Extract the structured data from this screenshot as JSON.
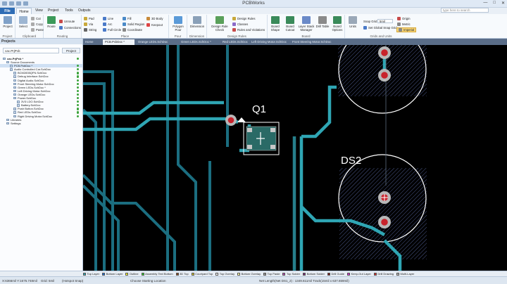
{
  "window": {
    "title": "PCBWorks"
  },
  "menu": {
    "tabs": [
      "File",
      "Home",
      "View",
      "Project",
      "Tools",
      "Outputs"
    ]
  },
  "search": {
    "placeholder": "type here to search"
  },
  "ribbon": {
    "groups": {
      "project": "Project",
      "clipboard": "Clipboard",
      "routing": "Routing",
      "place": "Place",
      "pour": "Pour",
      "dimension": "Dimension",
      "design_rules": "Design Rules",
      "board": "Board",
      "grids_units": "Grids and Units"
    },
    "buttons": {
      "project": "Project",
      "select": "Select",
      "cut": "Cut",
      "copy": "Copy",
      "paste": "Paste",
      "route": "Route",
      "unroute": "Unroute",
      "connections": "Connections",
      "pad": "Pad",
      "via": "Via",
      "string": "String",
      "line": "Line",
      "arc": "Arc",
      "full_circle": "Full Circle",
      "fill": "Fill",
      "solid_region": "Solid Region",
      "coordinate": "Coordinate",
      "3d_body": "3D Body",
      "keepout": "Keepout",
      "polygon_pour": "Polygon Pour",
      "dimension": "Dimension",
      "design_rule_check": "Design Rule Check",
      "design_rules": "Design Rules",
      "classes": "Classes",
      "rules_violations": "Rules and Violations",
      "board_shape": "Board Shape",
      "board_cutout": "Board Cutout",
      "layer_stack_manager": "Layer Stack Manager",
      "drill_table": "Drill Table",
      "board_options": "Board Options",
      "units": "Units",
      "snap_grid": "Snap Grid",
      "snap_grid_value": "5mil",
      "set_global_snap_grid": "Set Global Snap Grid...",
      "origin": "Origin",
      "metric": "Metric",
      "imperial": "Imperial"
    }
  },
  "projects_panel": {
    "title": "Projects",
    "filter_value": "cac.PrjPcb",
    "project_button": "Project",
    "tree": [
      {
        "label": "cac.PrjPcb *",
        "indent": 0,
        "bold": true,
        "dot": true
      },
      {
        "label": "Source Documents",
        "indent": 1,
        "dot": false
      },
      {
        "label": "PCB.PcbDoc *",
        "indent": 2,
        "dot": true,
        "selected": true
      },
      {
        "label": "Audio Controlled Car.SchDoc",
        "indent": 2,
        "dot": true
      },
      {
        "label": "BCM2835QFN.SchDoc",
        "indent": 3,
        "dot": true
      },
      {
        "label": "Debug Interface.SchDoc",
        "indent": 3,
        "dot": true
      },
      {
        "label": "Digital Audio.SchDoc",
        "indent": 3,
        "dot": true
      },
      {
        "label": "Front Steering Motor.SchDoc",
        "indent": 3,
        "dot": true
      },
      {
        "label": "Green LEDs.SchDoc *",
        "indent": 3,
        "dot": true
      },
      {
        "label": "Left Driving Motor.SchDoc",
        "indent": 3,
        "dot": true
      },
      {
        "label": "Orange LEDs.SchDoc",
        "indent": 3,
        "dot": true
      },
      {
        "label": "Power.SchDoc",
        "indent": 3,
        "dot": true
      },
      {
        "label": "3V3 LDO.SchDoc",
        "indent": 4,
        "dot": true
      },
      {
        "label": "Battery.SchDoc",
        "indent": 4,
        "dot": true
      },
      {
        "label": "Push Button.SchDoc",
        "indent": 3,
        "dot": true
      },
      {
        "label": "Red LEDs.SchDoc",
        "indent": 3,
        "dot": true
      },
      {
        "label": "Right Driving Motor.SchDoc",
        "indent": 3,
        "dot": true
      },
      {
        "label": "Libraries",
        "indent": 1,
        "dot": false
      },
      {
        "label": "Settings",
        "indent": 1,
        "dot": false
      }
    ]
  },
  "doc_tabs": [
    {
      "label": "Home",
      "active": false
    },
    {
      "label": "PCB.PcbDoc *",
      "active": true
    },
    {
      "label": "Orange LEDs.SchDoc",
      "active": false
    },
    {
      "label": "Green LEDs.SchDoc *",
      "active": false
    },
    {
      "label": "Red LEDs.SchDoc",
      "active": false
    },
    {
      "label": "Left Driving Motor.SchDoc",
      "active": false
    },
    {
      "label": "Front Steering Motor.SchDoc",
      "active": false
    }
  ],
  "pcb": {
    "designators": {
      "q1": "Q1",
      "ds2": "DS2"
    },
    "colors": {
      "background": "#000000",
      "top_layer_track": "#2fa6b4",
      "bottom_layer_track": "#1b6e80",
      "pad": "#b8b8b8",
      "pad_hole": "#c8232c",
      "overlay": "#ffffff",
      "component_body": "#2a6a66"
    }
  },
  "layers": [
    {
      "name": "Top Layer",
      "color": "#2fa6b4"
    },
    {
      "name": "Bottom Layer",
      "color": "#1f6ed4"
    },
    {
      "name": "Outline",
      "color": "#ffff33"
    },
    {
      "name": "Assembly Text Bottom",
      "color": "#2ed42e"
    },
    {
      "name": "3D Top",
      "color": "#8a4a20"
    },
    {
      "name": "Courtyard Top",
      "color": "#d4c82e"
    },
    {
      "name": "Top Overlay",
      "color": "#ffffff"
    },
    {
      "name": "Bottom Overlay",
      "color": "#ffffaa"
    },
    {
      "name": "Top Paste",
      "color": "#9a9a9a"
    },
    {
      "name": "Top Solder",
      "color": "#b84ab8"
    },
    {
      "name": "Bottom Solder",
      "color": "#7a2a7a"
    },
    {
      "name": "Drill Guide",
      "color": "#7a1a1a"
    },
    {
      "name": "Keep-Out Layer",
      "color": "#d42ed4"
    },
    {
      "name": "Drill Drawing",
      "color": "#d42e2e"
    },
    {
      "name": "Multi-Layer",
      "color": "#bcbcbc"
    }
  ],
  "status": {
    "coordinates": "X:6366mil Y:1675.748mil",
    "grid": "Grid: 5mil",
    "snap": "(Hotspot Snap)",
    "message": "Choose Starting Location",
    "net_info": "Net Length(Net DS1_2) : 1349.611mil  Track(15mil x 637.659mil)"
  }
}
